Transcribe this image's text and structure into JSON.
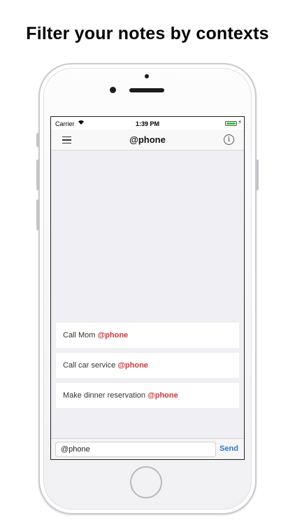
{
  "headline": "Filter your notes by contexts",
  "status_bar": {
    "carrier": "Carrier",
    "time": "1:39 PM"
  },
  "nav": {
    "title": "@phone",
    "info_glyph": "i"
  },
  "notes": [
    {
      "text": "Call Mom",
      "tag": "@phone"
    },
    {
      "text": "Call car service",
      "tag": "@phone"
    },
    {
      "text": "Make dinner reservation",
      "tag": "@phone"
    }
  ],
  "composer": {
    "value": "@phone",
    "send_label": "Send"
  },
  "colors": {
    "tag": "#d0373a",
    "send": "#2b78d8",
    "battery": "#3cc13c",
    "list_background": "#efeff4"
  },
  "icons": [
    "menu-icon",
    "info-icon",
    "wifi-icon",
    "battery-icon"
  ]
}
